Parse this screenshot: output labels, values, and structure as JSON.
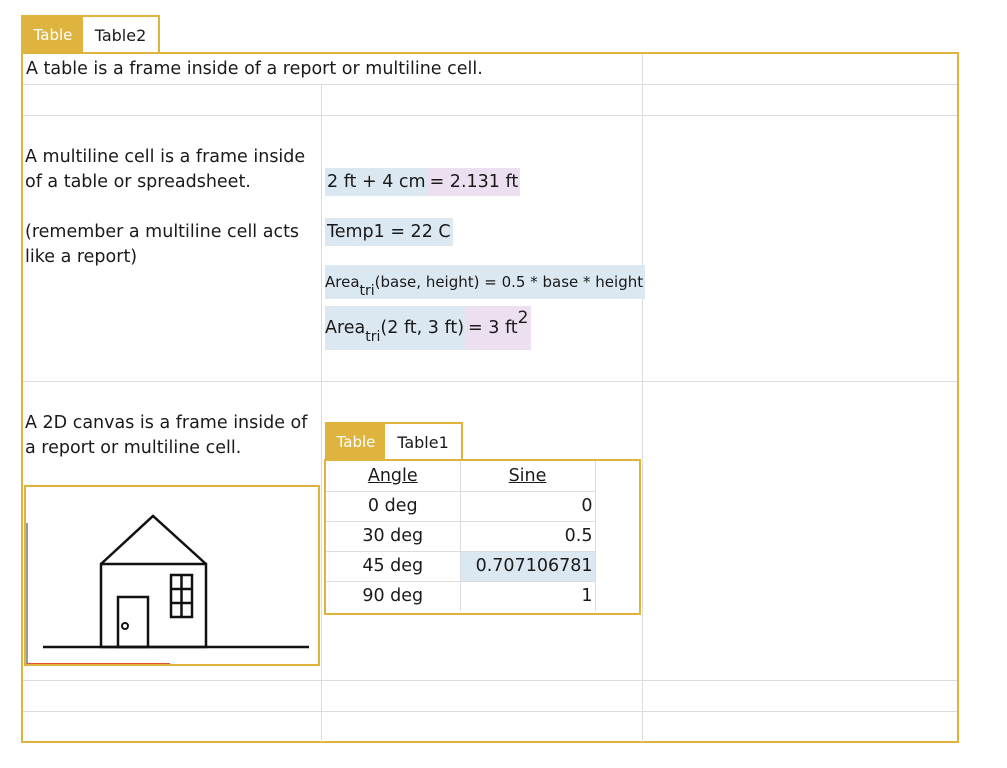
{
  "outer_tab": {
    "label": "Table",
    "name": "Table2"
  },
  "row1_text": "A table is a frame inside of a report or multiline cell.",
  "multiline_text_1": "A multiline cell is a frame inside of a table or spreadsheet.",
  "multiline_text_2": "(remember a multiline cell acts like a report)",
  "calc1": {
    "input": "2 ft + 4 cm",
    "result": "= 2.131 ft"
  },
  "calc2": {
    "input": "Temp1 = 22 C"
  },
  "calc3": {
    "name": "Area",
    "subscript": "tri",
    "args": "(base, height)",
    "body": "= 0.5 * base * height"
  },
  "calc4": {
    "name": "Area",
    "subscript": "tri",
    "args": "(2 ft, 3 ft)",
    "result": "= 3 ft",
    "exponent": "2"
  },
  "canvas_text": "A 2D canvas is a frame inside of a report or multiline cell.",
  "inner_tab": {
    "label": "Table",
    "name": "Table1"
  },
  "inner_table": {
    "headers": [
      "Angle",
      "Sine"
    ],
    "rows": [
      [
        "0 deg",
        "0"
      ],
      [
        "30 deg",
        "0.5"
      ],
      [
        "45 deg",
        "0.707106781"
      ],
      [
        "90 deg",
        "1"
      ]
    ]
  },
  "colors": {
    "accent": "#dfb43e",
    "calc_input": "#dbe8f1",
    "calc_result": "#ece0f0",
    "grid": "#dcdcdc"
  }
}
